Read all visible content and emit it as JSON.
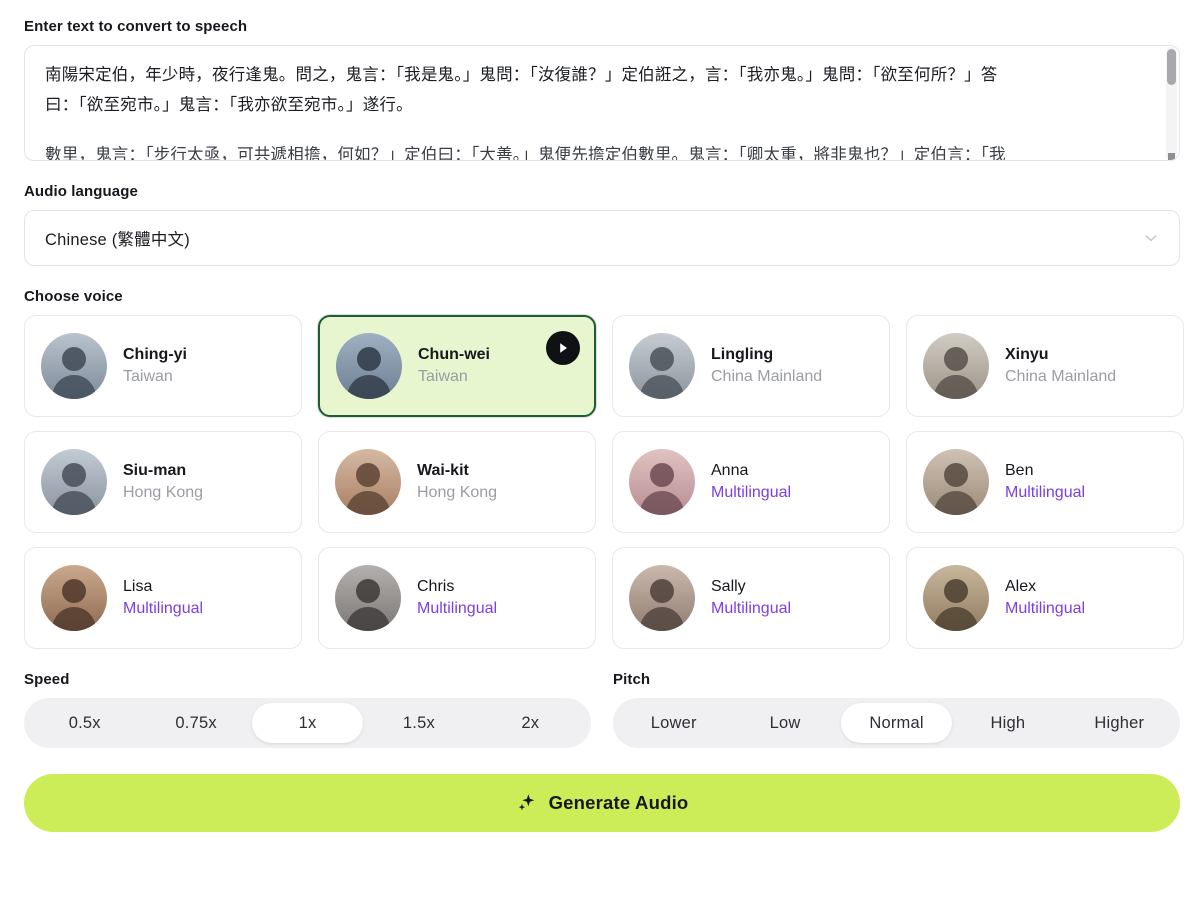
{
  "text_input": {
    "label": "Enter text to convert to speech",
    "lines": [
      "南陽宋定伯，年少時，夜行逢鬼。問之，鬼言：「我是鬼。」鬼問：「汝復誰？」定伯誑之，言：「我亦鬼。」鬼問：「欲至何所？」答",
      "曰：「欲至宛市。」鬼言：「我亦欲至宛市。」遂行。",
      "數里，鬼言：「步行太亟，可共遞相擔，何如？」定伯曰：「大善。」鬼便先擔定伯數里。鬼言：「卿太重，將非鬼也？」定伯言：「我"
    ],
    "scrollbar": {
      "name": "textarea-scrollbar"
    }
  },
  "language": {
    "label": "Audio language",
    "selected": "Chinese (繁體中文)",
    "chevron_icon": "chevron-down-icon"
  },
  "voices": {
    "label": "Choose voice",
    "play_icon": "play-icon",
    "items": [
      {
        "name": "Ching-yi",
        "region": "Taiwan",
        "type": "region",
        "selected": false
      },
      {
        "name": "Chun-wei",
        "region": "Taiwan",
        "type": "region",
        "selected": true
      },
      {
        "name": "Lingling",
        "region": "China Mainland",
        "type": "region",
        "selected": false
      },
      {
        "name": "Xinyu",
        "region": "China Mainland",
        "type": "region",
        "selected": false
      },
      {
        "name": "Siu-man",
        "region": "Hong Kong",
        "type": "region",
        "selected": false
      },
      {
        "name": "Wai-kit",
        "region": "Hong Kong",
        "type": "region",
        "selected": false
      },
      {
        "name": "Anna",
        "region": "Multilingual",
        "type": "multilingual",
        "selected": false
      },
      {
        "name": "Ben",
        "region": "Multilingual",
        "type": "multilingual",
        "selected": false
      },
      {
        "name": "Lisa",
        "region": "Multilingual",
        "type": "multilingual",
        "selected": false
      },
      {
        "name": "Chris",
        "region": "Multilingual",
        "type": "multilingual",
        "selected": false
      },
      {
        "name": "Sally",
        "region": "Multilingual",
        "type": "multilingual",
        "selected": false
      },
      {
        "name": "Alex",
        "region": "Multilingual",
        "type": "multilingual",
        "selected": false
      }
    ]
  },
  "speed": {
    "label": "Speed",
    "options": [
      "0.5x",
      "0.75x",
      "1x",
      "1.5x",
      "2x"
    ],
    "selected": "1x"
  },
  "pitch": {
    "label": "Pitch",
    "options": [
      "Lower",
      "Low",
      "Normal",
      "High",
      "Higher"
    ],
    "selected": "Normal"
  },
  "generate": {
    "label": "Generate Audio",
    "icon": "sparkle-icon"
  },
  "colors": {
    "accent_green": "#cced57",
    "selected_card_bg": "#e8f6cf",
    "selected_card_border": "#1f5c35",
    "multilingual_purple": "#7c3fe0",
    "muted_text": "#9a9da3"
  }
}
